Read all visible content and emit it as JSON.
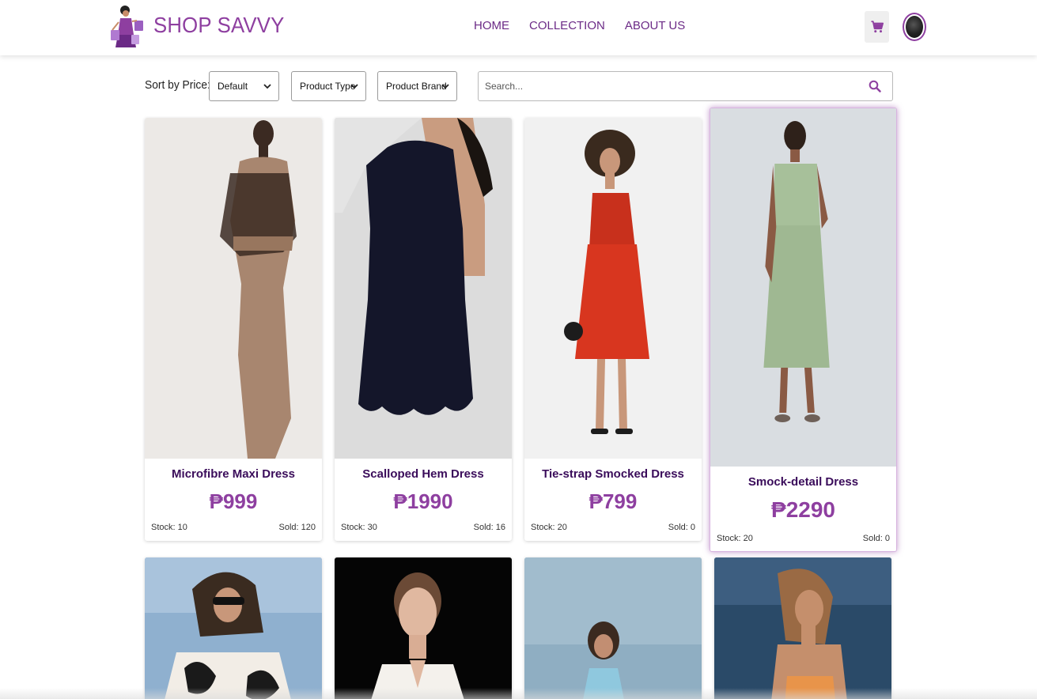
{
  "brand": {
    "name": "SHOP SAVVY",
    "logo_icon": "shopper-logo-icon"
  },
  "nav": {
    "home": "HOME",
    "collection": "COLLECTION",
    "about": "ABOUT US"
  },
  "header_actions": {
    "cart_icon": "cart-icon",
    "avatar_icon": "user-avatar-icon"
  },
  "filters": {
    "sort_label": "Sort by Price:",
    "sort_selected": "Default",
    "type_selected": "Product Type",
    "brand_selected": "Product Brand",
    "search_placeholder": "Search..."
  },
  "colors": {
    "accent": "#8e3fa0",
    "name_color": "#3a0c5a"
  },
  "products": [
    {
      "name": "Microfibre Maxi Dress",
      "price": "₱999",
      "stock": "Stock: 10",
      "sold": "Sold: 120"
    },
    {
      "name": "Scalloped Hem Dress",
      "price": "₱1990",
      "stock": "Stock: 30",
      "sold": "Sold: 16"
    },
    {
      "name": "Tie-strap Smocked Dress",
      "price": "₱799",
      "stock": "Stock: 20",
      "sold": "Sold: 0"
    },
    {
      "name": "Smock-detail Dress",
      "price": "₱2290",
      "stock": "Stock: 20",
      "sold": "Sold: 0"
    }
  ]
}
